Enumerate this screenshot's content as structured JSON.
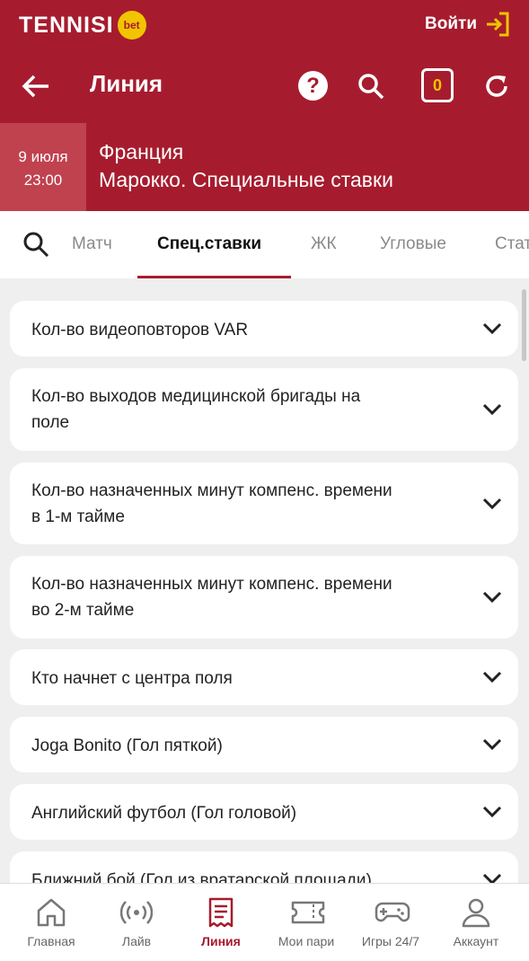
{
  "header": {
    "brand": "TENNISI",
    "brand_badge": "bet",
    "login_label": "Войти",
    "title": "Линия",
    "help_symbol": "?",
    "coupon_count": "0"
  },
  "event": {
    "date": "9 июля",
    "time": "23:00",
    "team1": "Франция",
    "team2": "Марокко. Специальные ставки"
  },
  "tabs": [
    {
      "label": "Матч"
    },
    {
      "label": "Спец.ставки"
    },
    {
      "label": "ЖК"
    },
    {
      "label": "Угловые"
    },
    {
      "label": "Статистика"
    }
  ],
  "markets": [
    {
      "line1": "Кол-во видеоповторов VAR",
      "line2": ""
    },
    {
      "line1": "Кол-во выходов медицинской бригады на",
      "line2": "поле"
    },
    {
      "line1": "Кол-во назначенных минут компенс. времени",
      "line2": "в 1-м тайме"
    },
    {
      "line1": "Кол-во назначенных минут компенс. времени",
      "line2": "во 2-м тайме"
    },
    {
      "line1": "Кто начнет с центра поля",
      "line2": ""
    },
    {
      "line1": "Joga Bonito (Гол пяткой)",
      "line2": ""
    },
    {
      "line1": "Английский футбол (Гол головой)",
      "line2": ""
    },
    {
      "line1": "Ближний бой (Гол из вратарской площади)",
      "line2": ""
    }
  ],
  "bottom_nav": [
    {
      "label": "Главная",
      "icon": "home-icon"
    },
    {
      "label": "Лайв",
      "icon": "live-icon"
    },
    {
      "label": "Линия",
      "icon": "line-icon"
    },
    {
      "label": "Мои пари",
      "icon": "ticket-icon"
    },
    {
      "label": "Игры 24/7",
      "icon": "gamepad-icon"
    },
    {
      "label": "Аккаунт",
      "icon": "account-icon"
    }
  ],
  "colors": {
    "brand": "#a61c2e",
    "accent": "#f2c400"
  }
}
